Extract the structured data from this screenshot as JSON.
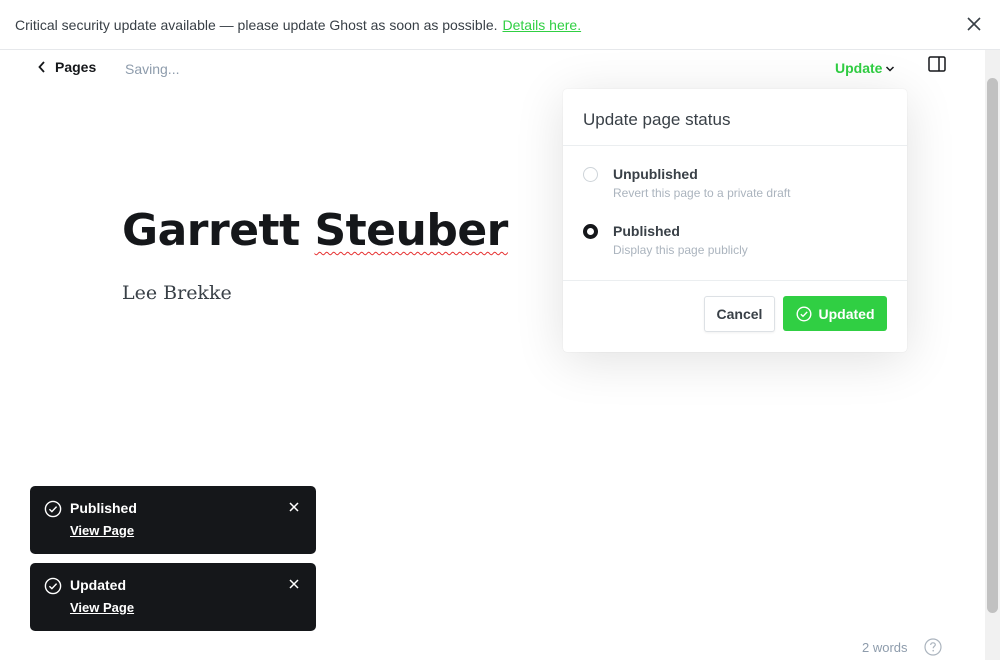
{
  "banner": {
    "message": "Critical security update available — please update Ghost as soon as possible.",
    "link_text": "Details here."
  },
  "header": {
    "back_label": "Pages",
    "status_text": "Saving...",
    "update_label": "Update"
  },
  "editor": {
    "title_part1": "Garrett",
    "title_part2": "Steuber",
    "subtitle": "Lee Brekke"
  },
  "publish_menu": {
    "title": "Update page status",
    "options": [
      {
        "label": "Unpublished",
        "description": "Revert this page to a private draft",
        "selected": false
      },
      {
        "label": "Published",
        "description": "Display this page publicly",
        "selected": true
      }
    ],
    "cancel_label": "Cancel",
    "confirm_label": "Updated"
  },
  "notifications": [
    {
      "message": "Published",
      "link": "View Page"
    },
    {
      "message": "Updated",
      "link": "View Page"
    }
  ],
  "footer": {
    "word_count": "2 words"
  },
  "colors": {
    "accent_green": "#30cf43",
    "dark": "#15171a",
    "muted": "#8e9cac"
  }
}
